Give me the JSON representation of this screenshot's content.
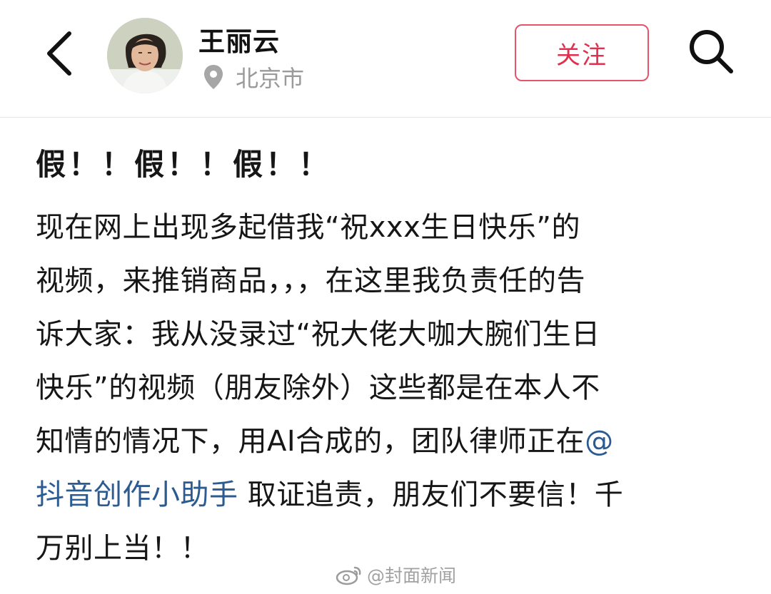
{
  "header": {
    "back_icon": "chevron-left-icon",
    "profile_name": "王丽云",
    "location_icon": "location-pin-icon",
    "location": "北京市",
    "follow_label": "关注",
    "search_icon": "search-icon",
    "accent_color": "#e0304d"
  },
  "post": {
    "title": "假！！假！！假！！",
    "lines": [
      "现在网上出现多起借我“祝xxx生日快乐”的",
      "视频，来推销商品，，，在这里我负责任的告",
      "诉大家：我从没录过“祝大佬大咖大腕们生日",
      "快乐”的视频（朋友除外）这些都是在本人不",
      "知情的情况下，用AI合成的，团队律师正在"
    ],
    "mention_at": "@",
    "mention": "抖音创作小助手",
    "after_mention": " 取证追责，朋友们不要信！千",
    "last_line": "万别上当！！",
    "mention_color": "#2c5b91"
  },
  "watermark": {
    "icon": "weibo-icon",
    "text": "@封面新闻"
  }
}
